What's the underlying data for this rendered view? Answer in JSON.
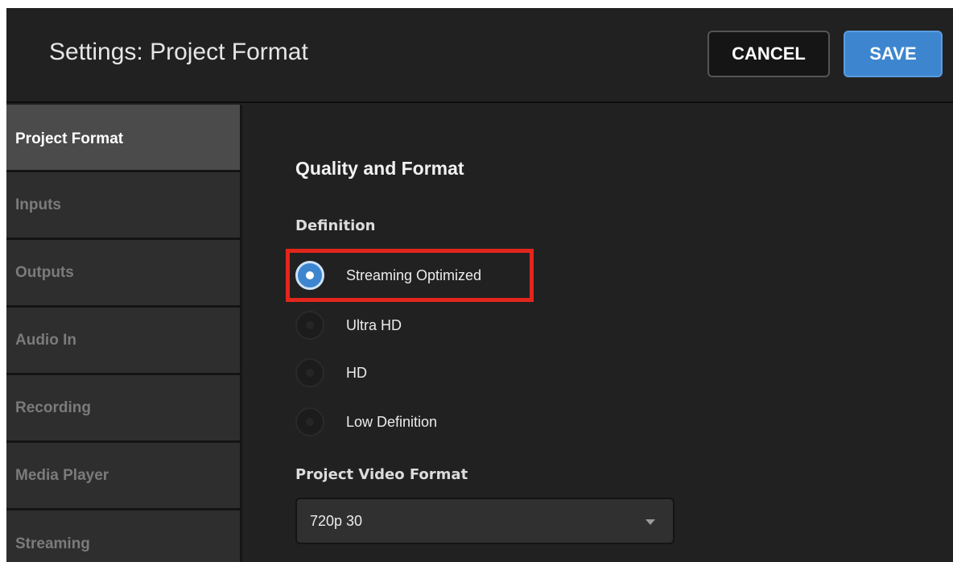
{
  "header": {
    "title": "Settings: Project Format",
    "cancel_label": "CANCEL",
    "save_label": "SAVE"
  },
  "sidebar": {
    "items": [
      {
        "label": "Project Format",
        "active": true
      },
      {
        "label": "Inputs",
        "active": false
      },
      {
        "label": "Outputs",
        "active": false
      },
      {
        "label": "Audio In",
        "active": false
      },
      {
        "label": "Recording",
        "active": false
      },
      {
        "label": "Media Player",
        "active": false
      },
      {
        "label": "Streaming",
        "active": false
      }
    ]
  },
  "main": {
    "section_title": "Quality and Format",
    "definition_label": "Definition",
    "definition_options": [
      {
        "label": "Streaming Optimized",
        "selected": true
      },
      {
        "label": "Ultra HD",
        "selected": false
      },
      {
        "label": "HD",
        "selected": false
      },
      {
        "label": "Low Definition",
        "selected": false
      }
    ],
    "video_format_label": "Project Video Format",
    "video_format_value": "720p 30"
  },
  "colors": {
    "accent": "#3d86cf",
    "highlight": "#e3261c",
    "background": "#212121",
    "sidebar": "#2e2e2e",
    "sidebar_active": "#4b4b4b"
  },
  "icons": {
    "select_arrow": "chevron-down-icon",
    "radio": "radio-icon"
  }
}
